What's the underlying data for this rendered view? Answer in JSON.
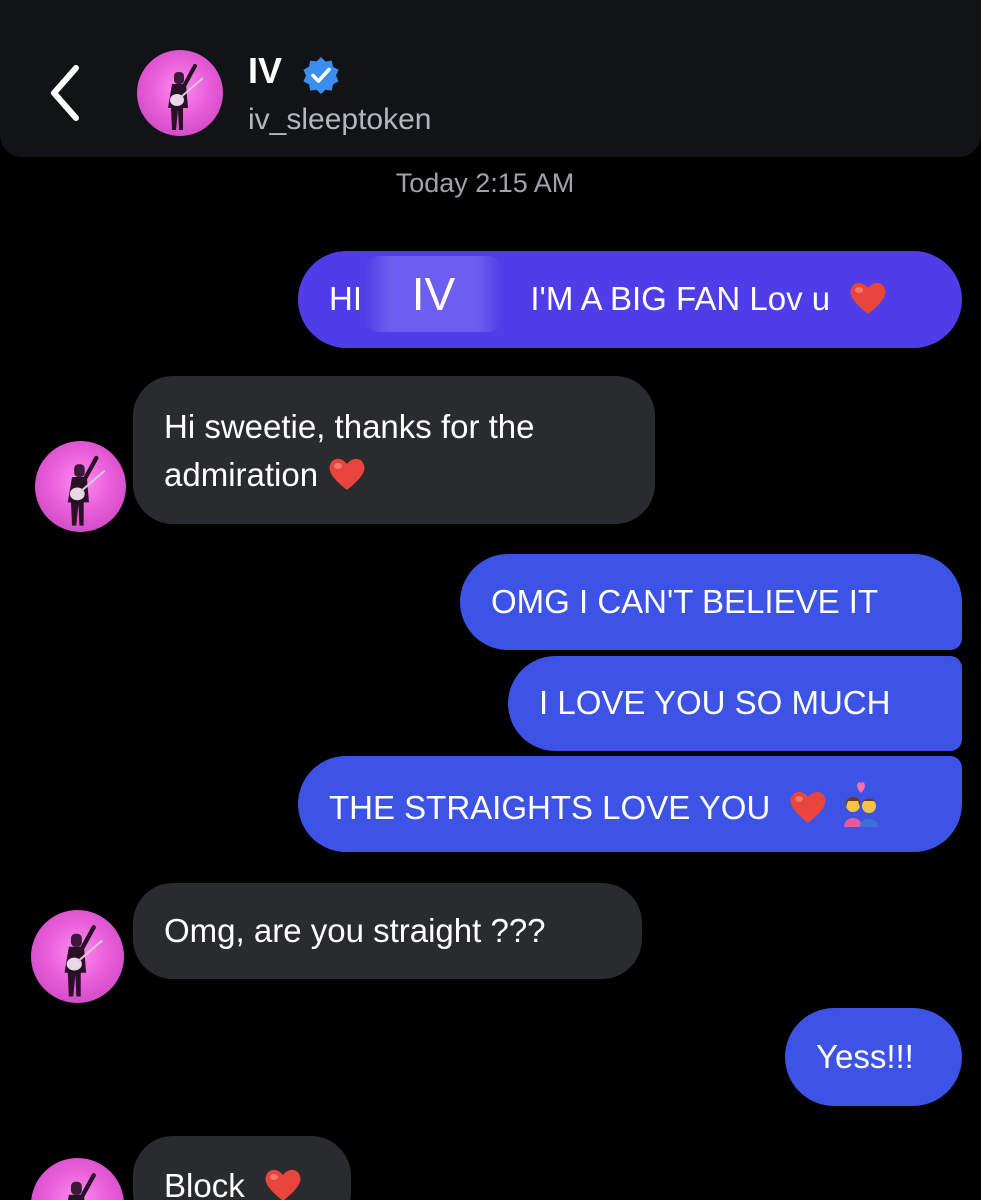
{
  "header": {
    "back_label": "<",
    "name": "IV",
    "handle": "iv_sleeptoken",
    "verified_icon": "verified-badge-icon",
    "avatar_icon": "profile-avatar"
  },
  "timestamp": "Today 2:15 AM",
  "messages": [
    {
      "from": "me",
      "prefix": "HI",
      "overlay": "IV",
      "text": "I'M A BIG FAN Lov u",
      "emoji": "heart"
    },
    {
      "from": "them",
      "line1": "Hi sweetie, thanks for the",
      "line2": "admiration",
      "emoji": "heart"
    },
    {
      "from": "me",
      "text": "OMG I CAN'T BELIEVE IT"
    },
    {
      "from": "me",
      "text": "I LOVE YOU SO MUCH"
    },
    {
      "from": "me",
      "text": "THE STRAIGHTS LOVE YOU",
      "emoji": "heart couple"
    },
    {
      "from": "them",
      "text": "Omg, are you straight ???"
    },
    {
      "from": "me",
      "text": "Yess!!!"
    },
    {
      "from": "them",
      "text": "Block",
      "emoji": "heart"
    }
  ],
  "colors": {
    "background": "#000000",
    "header": "#121316",
    "sent_purple": "#4f3ee7",
    "sent_blue": "#3d53e6",
    "received": "#2a2b2f",
    "avatar_pink": "#e85ed9",
    "verified_blue": "#3b8df0",
    "heart_red": "#e8453c"
  }
}
